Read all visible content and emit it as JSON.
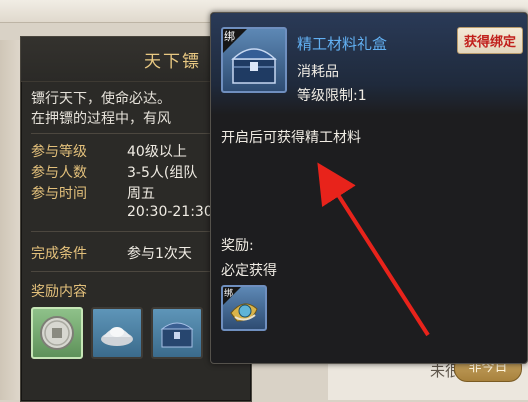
{
  "background": {
    "faint_text": "未很",
    "button_label": "非今日",
    "time_text": "30"
  },
  "panel": {
    "title": "天下镖",
    "description_lines": [
      "镖行天下，使命必达。",
      "在押镖的过程中，有风"
    ],
    "info": [
      {
        "label": "参与等级",
        "value": "40级以上"
      },
      {
        "label": "参与人数",
        "value": "3-5人(组队"
      },
      {
        "label": "参与时间",
        "value": "周五"
      }
    ],
    "time_value": "20:30-21:30",
    "complete": {
      "label": "完成条件",
      "value": "参与1次天"
    },
    "reward_label": "奖励内容",
    "reward_icons": [
      "coin-icon",
      "silver-ingot-icon",
      "chest-icon"
    ]
  },
  "tooltip": {
    "bind_tag": "绑",
    "item_name": "精工材料礼盒",
    "item_type": "消耗品",
    "item_level_label": "等级限制:",
    "item_level": "1",
    "bind_badge": "获得绑定",
    "effect": "开启后可获得精工材料",
    "reward_label": "奖励:",
    "reward_guarantee": "必定获得",
    "reward_icon": "material-gem-icon"
  },
  "colors": {
    "item_name": "#62b0f2",
    "label_gold": "#e3c07b",
    "badge_red": "#c1201c",
    "arrow_red": "#e8231b"
  }
}
